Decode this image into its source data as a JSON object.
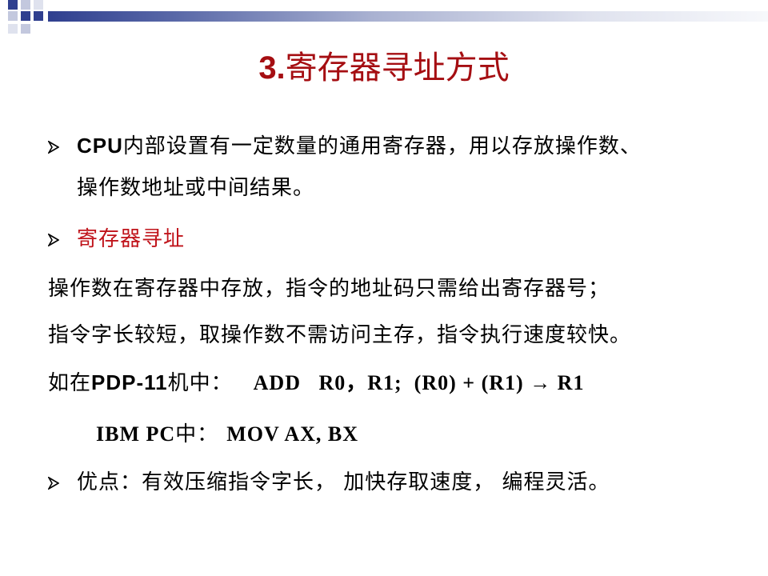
{
  "title": {
    "num": "3.",
    "text": "寄存器寻址方式"
  },
  "bullet1": {
    "prefix": "CPU",
    "line1": "内部设置有一定数量的通用寄存器，用以存放操作数、",
    "line2": "操作数地址或中间结果。"
  },
  "bullet2": {
    "text": "寄存器寻址"
  },
  "para1": "操作数在寄存器中存放，指令的地址码只需给出寄存器号；",
  "para2": "指令字长较短，取操作数不需访问主存，指令执行速度较快。",
  "example1": {
    "lead": "如在",
    "machine": "PDP-11",
    "tail": "机中：",
    "instr": "ADD   R0，R1;  (R0) + (R1) → R1"
  },
  "example2": {
    "machine": "IBM PC",
    "tail": "中：",
    "instr": "MOV AX, BX"
  },
  "bullet3": {
    "text": "优点：有效压缩指令字长， 加快存取速度， 编程灵活。"
  },
  "colors": {
    "title": "#a50e12",
    "highlight": "#c0141b",
    "bar": "#2f3f8f"
  },
  "icons": {
    "bullet": "arrow-bullet-icon"
  }
}
